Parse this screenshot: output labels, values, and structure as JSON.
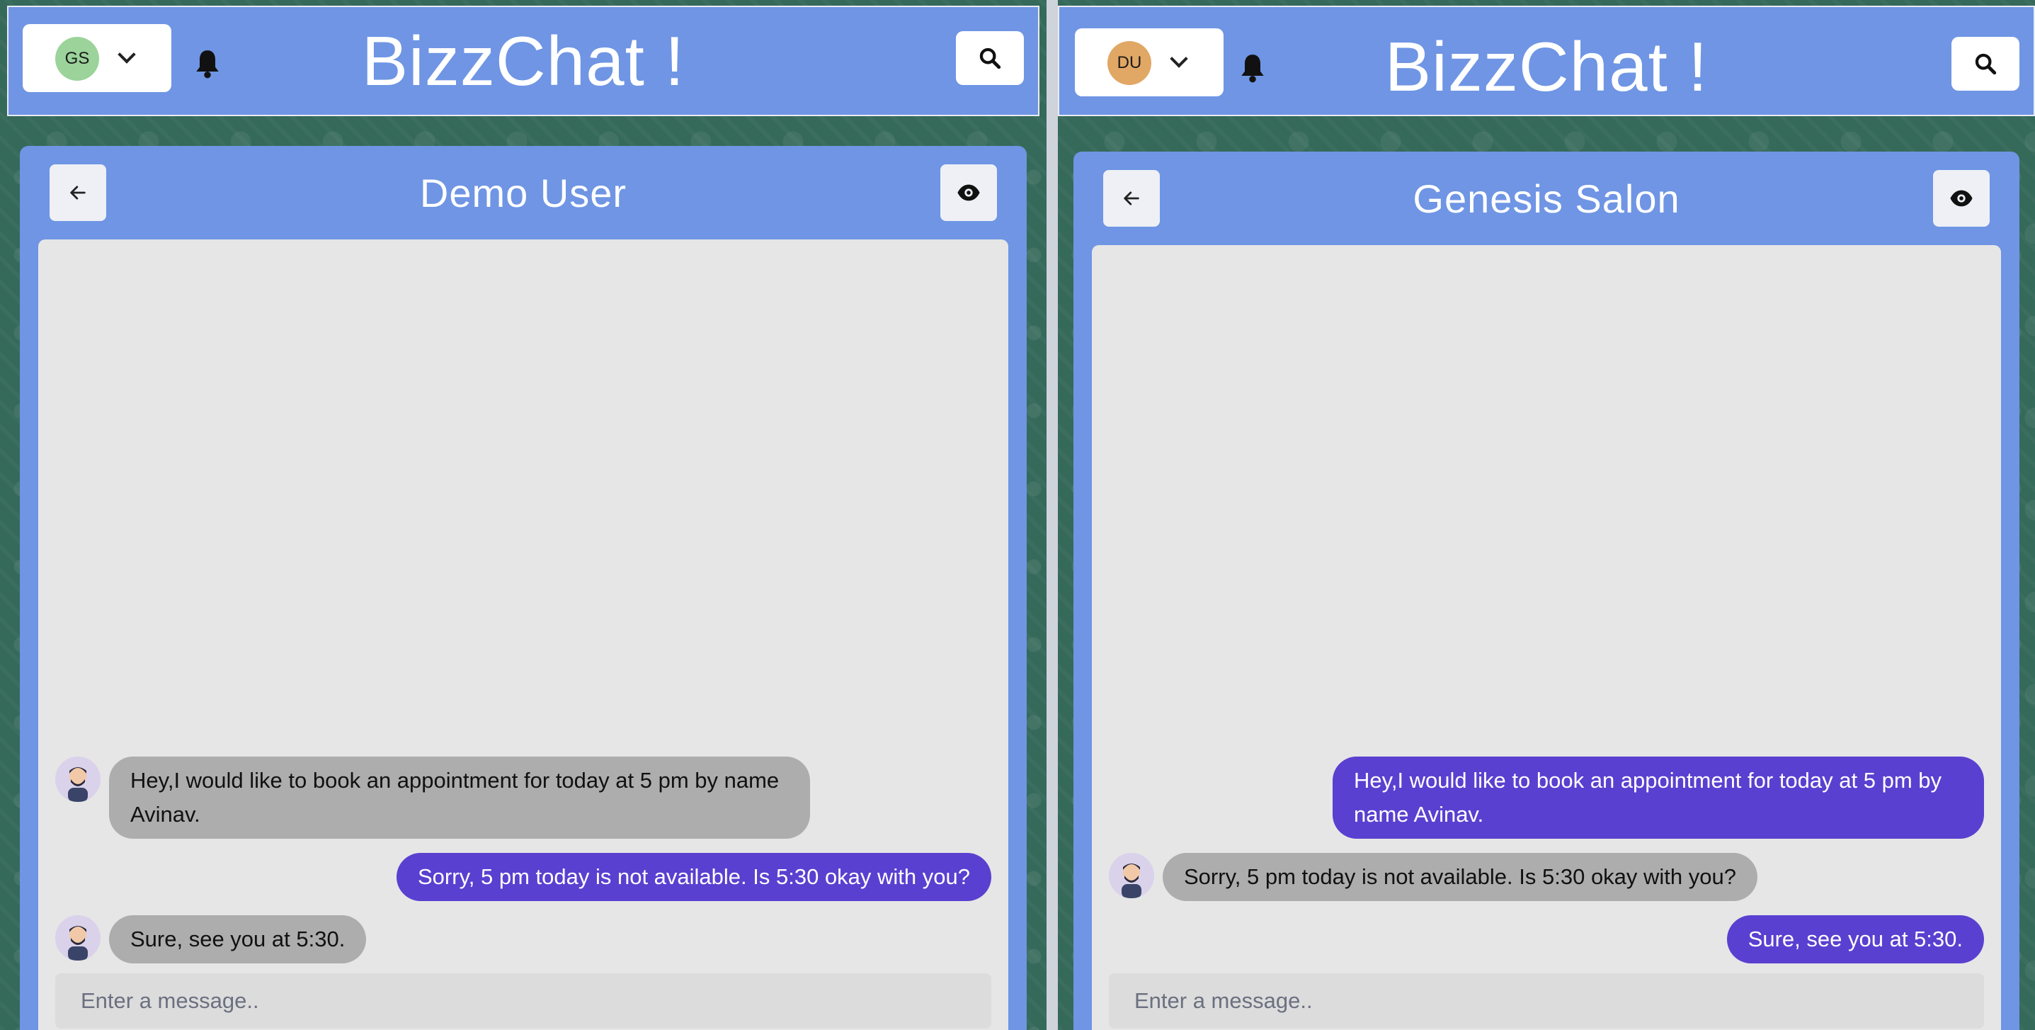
{
  "left": {
    "app_title": "BizzChat !",
    "user_initials": "GS",
    "avatar_color": "#9bd39a",
    "chat_title": "Demo User",
    "input_placeholder": "Enter a message..",
    "messages": [
      {
        "direction": "in",
        "text": "Hey,I would like to book an appointment for today at 5 pm by name Avinav."
      },
      {
        "direction": "out",
        "text": "Sorry, 5 pm today is not available. Is 5:30 okay with you?"
      },
      {
        "direction": "in",
        "text": "Sure, see you at 5:30."
      }
    ]
  },
  "right": {
    "app_title": "BizzChat !",
    "user_initials": "DU",
    "avatar_color": "#e1a765",
    "chat_title": "Genesis Salon",
    "input_placeholder": "Enter a message..",
    "messages": [
      {
        "direction": "out",
        "text": "Hey,I would like to book an appointment for today at 5 pm by name Avinav."
      },
      {
        "direction": "in",
        "text": "Sorry, 5 pm today is not available. Is 5:30 okay with you?"
      },
      {
        "direction": "out",
        "text": "Sure, see you at 5:30."
      }
    ]
  },
  "colors": {
    "header": "#6f95e4",
    "outgoing_bubble": "#5a40d0",
    "incoming_bubble": "#adadad",
    "chat_background": "#e6e6e6"
  },
  "icons": {
    "bell": "bell-icon",
    "search": "search-icon",
    "back": "arrow-left-icon",
    "view": "eye-icon",
    "dropdown": "chevron-down-icon"
  }
}
